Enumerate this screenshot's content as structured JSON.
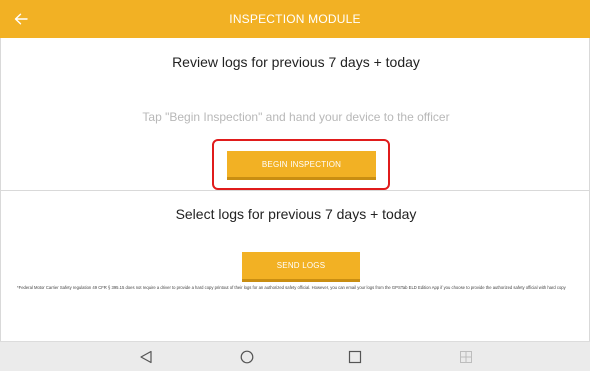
{
  "app_bar": {
    "title": "INSPECTION MODULE",
    "back_icon": "back-arrow-icon",
    "color": "#f2b124"
  },
  "review": {
    "heading": "Review logs for previous 7 days + today",
    "hint": "Tap \"Begin Inspection\" and hand your device to the officer",
    "button_label": "BEGIN INSPECTION",
    "highlight_color": "#e01b1b"
  },
  "send": {
    "heading": "Select logs for previous 7 days + today",
    "button_label": "SEND LOGS"
  },
  "disclaimer": "*Federal Motor Carrier Safety regulation 49 CFR § 395.15 does not require a driver to provide a hard copy printout of their logs for an authorized safety official. However, you can email your logs from the GPSTab ELD Edition App if you choose to provide the authorized safety official with hard copy",
  "nav_bar": {
    "back_icon": "triangle-back-icon",
    "home_icon": "circle-home-icon",
    "recents_icon": "square-recents-icon",
    "split_icon": "split-screen-icon"
  }
}
